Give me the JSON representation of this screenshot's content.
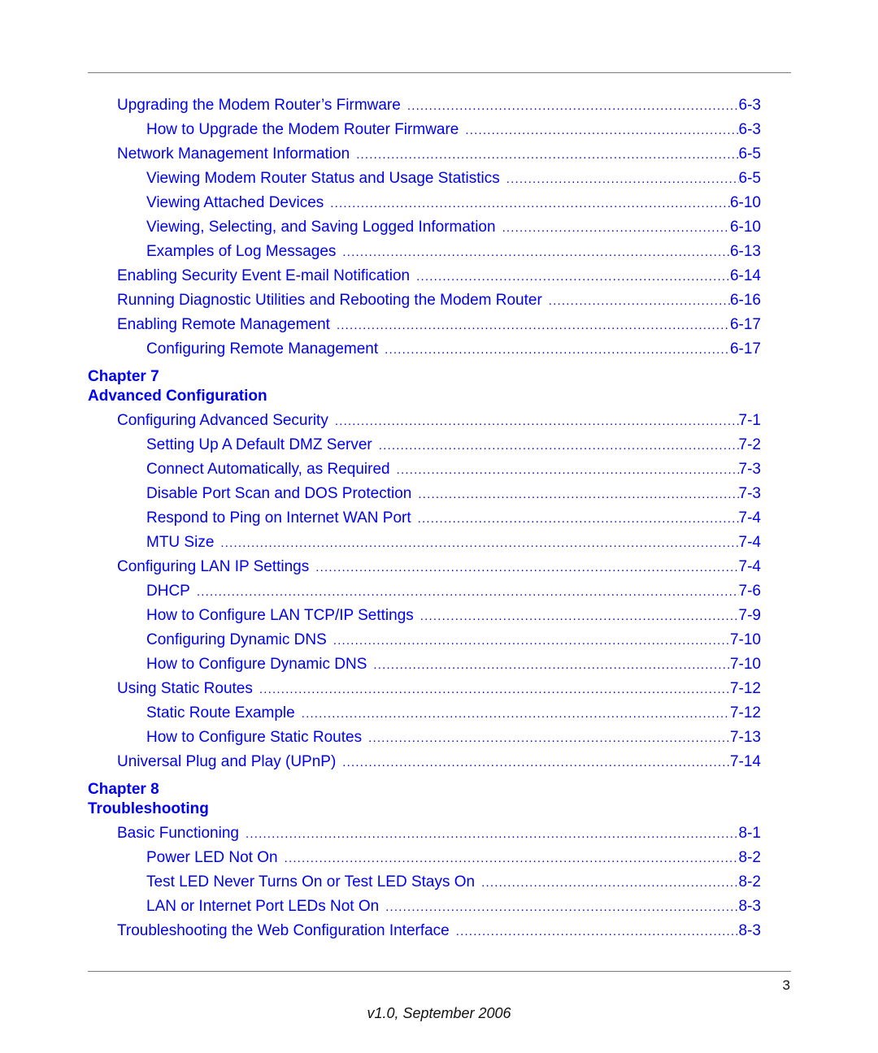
{
  "toc": {
    "group1": [
      {
        "level": 1,
        "title": "Upgrading the Modem Router’s Firmware",
        "page": "6-3"
      },
      {
        "level": 2,
        "title": "How to Upgrade the Modem Router Firmware",
        "page": "6-3"
      },
      {
        "level": 1,
        "title": "Network Management Information",
        "page": "6-5"
      },
      {
        "level": 2,
        "title": "Viewing Modem Router Status and Usage Statistics",
        "page": "6-5"
      },
      {
        "level": 2,
        "title": "Viewing Attached Devices",
        "page": "6-10"
      },
      {
        "level": 2,
        "title": "Viewing, Selecting, and Saving Logged Information",
        "page": "6-10"
      },
      {
        "level": 2,
        "title": "Examples of Log Messages",
        "page": "6-13"
      },
      {
        "level": 1,
        "title": "Enabling Security Event E-mail Notification",
        "page": "6-14"
      },
      {
        "level": 1,
        "title": "Running Diagnostic Utilities and Rebooting the Modem Router",
        "page": "6-16"
      },
      {
        "level": 1,
        "title": "Enabling Remote Management",
        "page": "6-17"
      },
      {
        "level": 2,
        "title": "Configuring Remote Management",
        "page": "6-17"
      }
    ],
    "chapter7": {
      "label": "Chapter 7",
      "title": "Advanced Configuration",
      "entries": [
        {
          "level": 1,
          "title": "Configuring Advanced Security",
          "page": "7-1"
        },
        {
          "level": 2,
          "title": "Setting Up A Default DMZ Server",
          "page": "7-2"
        },
        {
          "level": 2,
          "title": "Connect Automatically, as Required",
          "page": "7-3"
        },
        {
          "level": 2,
          "title": "Disable Port Scan and DOS Protection",
          "page": "7-3"
        },
        {
          "level": 2,
          "title": "Respond to Ping on Internet WAN Port",
          "page": "7-4"
        },
        {
          "level": 2,
          "title": "MTU Size",
          "page": "7-4"
        },
        {
          "level": 1,
          "title": "Configuring LAN IP Settings",
          "page": "7-4"
        },
        {
          "level": 2,
          "title": "DHCP",
          "page": "7-6"
        },
        {
          "level": 2,
          "title": "How to Configure LAN TCP/IP Settings",
          "page": "7-9"
        },
        {
          "level": 2,
          "title": "Configuring Dynamic DNS",
          "page": "7-10"
        },
        {
          "level": 2,
          "title": "How to Configure Dynamic DNS",
          "page": "7-10"
        },
        {
          "level": 1,
          "title": "Using Static Routes",
          "page": "7-12"
        },
        {
          "level": 2,
          "title": "Static Route Example",
          "page": "7-12"
        },
        {
          "level": 2,
          "title": "How to Configure Static Routes",
          "page": "7-13"
        },
        {
          "level": 1,
          "title": "Universal Plug and Play (UPnP)",
          "page": "7-14"
        }
      ]
    },
    "chapter8": {
      "label": "Chapter 8",
      "title": "Troubleshooting",
      "entries": [
        {
          "level": 1,
          "title": "Basic Functioning",
          "page": "8-1"
        },
        {
          "level": 2,
          "title": "Power LED Not On",
          "page": "8-2"
        },
        {
          "level": 2,
          "title": "Test LED Never Turns On or Test LED Stays On",
          "page": "8-2"
        },
        {
          "level": 2,
          "title": "LAN or Internet Port LEDs Not On",
          "page": "8-3"
        },
        {
          "level": 1,
          "title": "Troubleshooting the Web Configuration Interface",
          "page": "8-3"
        }
      ]
    }
  },
  "page_number": "3",
  "footer": "v1.0, September 2006",
  "colors": {
    "link": "#0000f0",
    "rule": "#7a7a7a"
  }
}
